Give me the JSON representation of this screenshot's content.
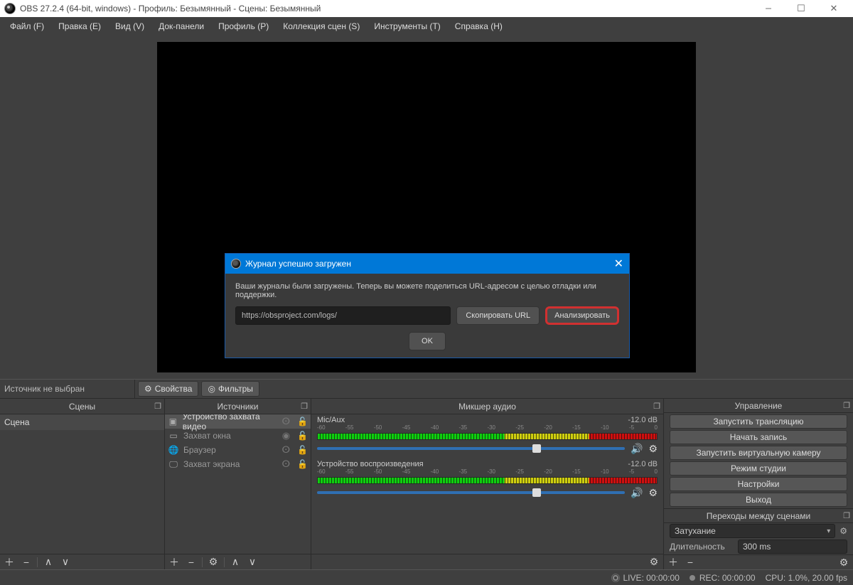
{
  "window": {
    "title": "OBS 27.2.4 (64-bit, windows) - Профиль: Безымянный - Сцены: Безымянный"
  },
  "menu": {
    "items": [
      "Файл (F)",
      "Правка (E)",
      "Вид (V)",
      "Док-панели",
      "Профиль (P)",
      "Коллекция сцен (S)",
      "Инструменты (T)",
      "Справка (H)"
    ]
  },
  "source_strip": {
    "label": "Источник не выбран",
    "properties_btn": "Свойства",
    "filters_btn": "Фильтры"
  },
  "docks": {
    "scenes": {
      "title": "Сцены",
      "items": [
        "Сцена"
      ]
    },
    "sources": {
      "title": "Источники",
      "items": [
        {
          "name": "Устройство захвата видео"
        },
        {
          "name": "Захват окна"
        },
        {
          "name": "Браузер"
        },
        {
          "name": "Захват экрана"
        }
      ]
    },
    "mixer": {
      "title": "Микшер аудио",
      "scale_marks": [
        "-60",
        "-55",
        "-50",
        "-45",
        "-40",
        "-35",
        "-30",
        "-25",
        "-20",
        "-15",
        "-10",
        "-5",
        "0"
      ],
      "channels": [
        {
          "name": "Mic/Aux",
          "db": "-12.0 dB"
        },
        {
          "name": "Устройство воспроизведения",
          "db": "-12.0 dB"
        }
      ]
    },
    "controls": {
      "title": "Управление",
      "buttons": [
        "Запустить трансляцию",
        "Начать запись",
        "Запустить виртуальную камеру",
        "Режим студии",
        "Настройки",
        "Выход"
      ]
    },
    "transitions": {
      "title": "Переходы между сценами",
      "selected": "Затухание",
      "duration_label": "Длительность",
      "duration_value": "300 ms"
    }
  },
  "status": {
    "live": "LIVE: 00:00:00",
    "rec": "REC: 00:00:00",
    "cpu": "CPU: 1.0%, 20.00 fps"
  },
  "dialog": {
    "title": "Журнал успешно загружен",
    "message": "Ваши журналы были загружены. Теперь вы можете поделиться URL-адресом с целью отладки или поддержки.",
    "url": "https://obsproject.com/logs/",
    "copy_btn": "Скопировать URL",
    "analyze_btn": "Анализировать",
    "ok_btn": "OK"
  }
}
